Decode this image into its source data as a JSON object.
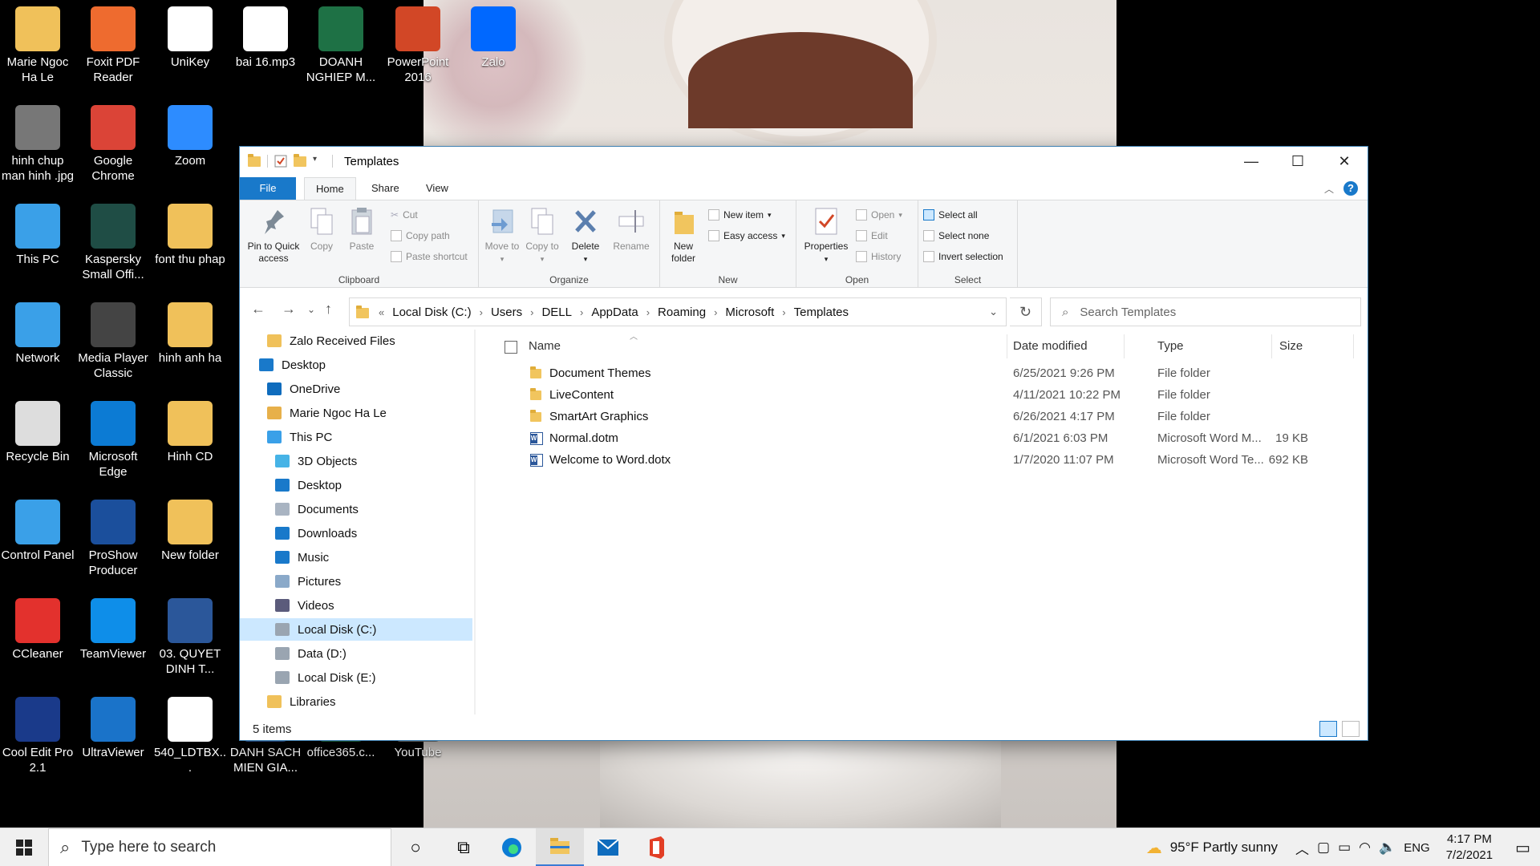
{
  "desktop": {
    "icons": [
      {
        "label": "Marie Ngoc Ha Le",
        "icon": "user-folder-icon",
        "color": "#f0c15a"
      },
      {
        "label": "Foxit PDF Reader",
        "icon": "foxit-icon",
        "color": "#ee6b2f"
      },
      {
        "label": "UniKey",
        "icon": "unikey-icon",
        "color": "#ffffff"
      },
      {
        "label": "bai 16.mp3",
        "icon": "audio-file-icon",
        "color": "#ffffff"
      },
      {
        "label": "DOANH NGHIEP  M...",
        "icon": "excel-file-icon",
        "color": "#1e7145"
      },
      {
        "label": "PowerPoint 2016",
        "icon": "powerpoint-icon",
        "color": "#d24726"
      },
      {
        "label": "Zalo",
        "icon": "zalo-icon",
        "color": "#0068ff"
      },
      {
        "label": "hinh chup man hinh .jpg",
        "icon": "image-file-icon",
        "color": "#777777"
      },
      {
        "label": "Google Chrome",
        "icon": "chrome-icon",
        "color": "#db4437"
      },
      {
        "label": "Zoom",
        "icon": "zoom-icon",
        "color": "#2d8cff"
      },
      {
        "label": "This PC",
        "icon": "computer-icon",
        "color": "#3aa0e8"
      },
      {
        "label": "Kaspersky Small Offi...",
        "icon": "kaspersky-icon",
        "color": "#1f4d45"
      },
      {
        "label": "font thu phap",
        "icon": "folder-icon",
        "color": "#f0c15a"
      },
      {
        "label": "Network",
        "icon": "network-icon",
        "color": "#3aa0e8"
      },
      {
        "label": "Media Player Classic",
        "icon": "media-player-icon",
        "color": "#444444"
      },
      {
        "label": "hinh anh ha",
        "icon": "folder-icon",
        "color": "#f0c15a"
      },
      {
        "label": "Recycle Bin",
        "icon": "recycle-bin-icon",
        "color": "#dddddd"
      },
      {
        "label": "Microsoft Edge",
        "icon": "edge-icon",
        "color": "#0c7bd4"
      },
      {
        "label": "Hinh CD",
        "icon": "folder-icon",
        "color": "#f0c15a"
      },
      {
        "label": "Control Panel",
        "icon": "control-panel-icon",
        "color": "#3aa0e8"
      },
      {
        "label": "ProShow Producer",
        "icon": "proshow-icon",
        "color": "#1b4f9c"
      },
      {
        "label": "New folder",
        "icon": "folder-icon",
        "color": "#f0c15a"
      },
      {
        "label": "CCleaner",
        "icon": "ccleaner-icon",
        "color": "#e3312d"
      },
      {
        "label": "TeamViewer",
        "icon": "teamviewer-icon",
        "color": "#0e8ee9"
      },
      {
        "label": "03. QUYET DINH T...",
        "icon": "word-file-icon",
        "color": "#2b579a"
      },
      {
        "label": "Cool Edit Pro 2.1",
        "icon": "cool-edit-icon",
        "color": "#1a3a8a"
      },
      {
        "label": "UltraViewer",
        "icon": "ultraviewer-icon",
        "color": "#1a73c9"
      },
      {
        "label": "540_LDTBX...",
        "icon": "document-file-icon",
        "color": "#ffffff"
      },
      {
        "label": "DANH SACH MIEN GIA...",
        "icon": "word-file-icon",
        "color": "#2b579a"
      },
      {
        "label": "office365.c...",
        "icon": "excel-file-icon",
        "color": "#1e7145"
      },
      {
        "label": "YouTube",
        "icon": "youtube-icon",
        "color": "#777777"
      }
    ]
  },
  "explorer": {
    "title": "Templates",
    "tabs": {
      "file": "File",
      "home": "Home",
      "share": "Share",
      "view": "View"
    },
    "ribbon": {
      "clipboard": {
        "label": "Clipboard",
        "pin": "Pin to Quick access",
        "copy": "Copy",
        "paste": "Paste",
        "cut": "Cut",
        "copy_path": "Copy path",
        "paste_shortcut": "Paste shortcut"
      },
      "organize": {
        "label": "Organize",
        "move_to": "Move to",
        "copy_to": "Copy to",
        "delete": "Delete",
        "rename": "Rename"
      },
      "new": {
        "label": "New",
        "new_folder": "New folder",
        "new_item": "New item",
        "easy_access": "Easy access"
      },
      "open": {
        "label": "Open",
        "properties": "Properties",
        "open": "Open",
        "edit": "Edit",
        "history": "History"
      },
      "select": {
        "label": "Select",
        "select_all": "Select all",
        "select_none": "Select none",
        "invert": "Invert selection"
      }
    },
    "address": {
      "crumbs": [
        "Local Disk (C:)",
        "Users",
        "DELL",
        "AppData",
        "Roaming",
        "Microsoft",
        "Templates"
      ],
      "search_placeholder": "Search Templates"
    },
    "nav": [
      {
        "label": "Zalo Received Files",
        "indent": 1,
        "color": "#f0c15a"
      },
      {
        "label": "Desktop",
        "indent": 0,
        "color": "#1979ca"
      },
      {
        "label": "OneDrive",
        "indent": 1,
        "color": "#0f6cbd"
      },
      {
        "label": "Marie Ngoc Ha Le",
        "indent": 1,
        "color": "#e7b04a"
      },
      {
        "label": "This PC",
        "indent": 1,
        "color": "#3aa0e8"
      },
      {
        "label": "3D Objects",
        "indent": 2,
        "color": "#46b3e6"
      },
      {
        "label": "Desktop",
        "indent": 2,
        "color": "#1979ca"
      },
      {
        "label": "Documents",
        "indent": 2,
        "color": "#a9b4c2"
      },
      {
        "label": "Downloads",
        "indent": 2,
        "color": "#1979ca"
      },
      {
        "label": "Music",
        "indent": 2,
        "color": "#1979ca"
      },
      {
        "label": "Pictures",
        "indent": 2,
        "color": "#8aa9c9"
      },
      {
        "label": "Videos",
        "indent": 2,
        "color": "#5b5b7b"
      },
      {
        "label": "Local Disk (C:)",
        "indent": 2,
        "color": "#9aa5b1",
        "selected": true
      },
      {
        "label": "Data (D:)",
        "indent": 2,
        "color": "#9aa5b1"
      },
      {
        "label": "Local Disk (E:)",
        "indent": 2,
        "color": "#9aa5b1"
      },
      {
        "label": "Libraries",
        "indent": 1,
        "color": "#f0c15a"
      }
    ],
    "columns": {
      "name": "Name",
      "date": "Date modified",
      "type": "Type",
      "size": "Size"
    },
    "files": [
      {
        "name": "Document Themes",
        "date": "6/25/2021 9:26 PM",
        "type": "File folder",
        "size": "",
        "kind": "folder"
      },
      {
        "name": "LiveContent",
        "date": "4/11/2021 10:22 PM",
        "type": "File folder",
        "size": "",
        "kind": "folder"
      },
      {
        "name": "SmartArt Graphics",
        "date": "6/26/2021 4:17 PM",
        "type": "File folder",
        "size": "",
        "kind": "folder"
      },
      {
        "name": "Normal.dotm",
        "date": "6/1/2021 6:03 PM",
        "type": "Microsoft Word M...",
        "size": "19 KB",
        "kind": "word"
      },
      {
        "name": "Welcome to Word.dotx",
        "date": "1/7/2020 11:07 PM",
        "type": "Microsoft Word Te...",
        "size": "692 KB",
        "kind": "word"
      }
    ],
    "status": {
      "count": "5 items"
    }
  },
  "taskbar": {
    "search_placeholder": "Type here to search",
    "weather": "95°F  Partly sunny",
    "lang": "ENG",
    "time": "4:17 PM",
    "date": "7/2/2021"
  }
}
